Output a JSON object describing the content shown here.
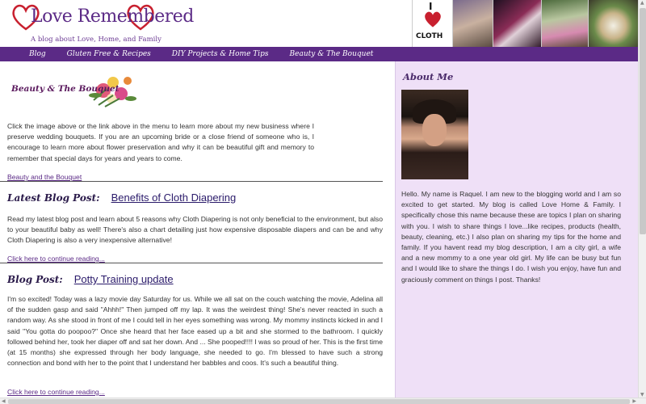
{
  "header": {
    "logo_title": "Love Remembered",
    "logo_tagline": "A blog about Love, Home, and Family",
    "cloth_badge": {
      "top_text": "I",
      "bottom_text": "CLOTH"
    }
  },
  "nav": {
    "items": [
      {
        "label": "Blog"
      },
      {
        "label": "Gluten Free & Recipes"
      },
      {
        "label": "DIY Projects & Home Tips"
      },
      {
        "label": "Beauty & The Bouquet"
      }
    ]
  },
  "main": {
    "bouquet_logo_text": "Beauty & The Bouquet",
    "intro_text": "Click the image above or the link above in the menu to learn more about my new business where I preserve wedding bouquets. If you are an upcoming bride or a close friend of someone who is, I encourage to learn more about flower preservation and why it can be beautiful gift and memory to remember that special days for years and years to come.",
    "intro_link": "Beauty and the Bouquet",
    "latest_post": {
      "label": "Latest Blog Post:",
      "title": "Benefits of Cloth Diapering",
      "excerpt": "Read my latest blog post and learn about 5 reasons why Cloth Diapering is not only beneficial to the environment, but also to your beautiful baby as well! There's also a chart detailing just how expensive disposable diapers and can be and why Cloth Diapering is also a very inexpensive alternative!",
      "link": "Click here to continue reading..."
    },
    "blog_post": {
      "label": "Blog Post:",
      "title": "Potty Training update",
      "excerpt": "I'm so excited! Today was a lazy movie day Saturday for us. While we all sat on the couch watching the movie, Adelina all of the sudden gasp and said \"Ahhh!\" Then jumped off my lap. It was the weirdest thing! She's never reacted in such a random way. As she stood in front of me I could tell in her eyes something was wrong. My mommy instincts kicked in and I said \"You gotta do poopoo?\" Once she heard that her face eased up a bit and she stormed to the bathroom. I quickly followed behind her, took her diaper off and sat her down. And ... She pooped!!!! I was so proud of her. This is the first time (at 15 months) she expressed through her body language, she needed to go. I'm blessed to have such a strong connection and bond with her to the point that I understand her babbles and coos. It's such a beautiful thing.",
      "link": "Click here to continue reading..."
    }
  },
  "sidebar": {
    "about_title": "About Me",
    "about_text": "Hello. My name is Raquel. I am new to the blogging world and I am so excited to get started. My blog is called Love Home & Family. I specifically chose this name because these are topics I plan on sharing with you. I wish to share things I love...like recipes, products (health, beauty, cleaning, etc.) I also plan on sharing my tips for the home and family. If you havent read my blog description, I am a city girl, a wife and a new mommy to a one year old girl. My life can be busy but fun and I would like to share the things I do. I wish you enjoy, have fun and graciously comment on things I post. Thanks!"
  },
  "colors": {
    "brand_purple": "#5b2a86",
    "sidebar_bg": "#efe0f7",
    "heart_red": "#c8202f"
  }
}
